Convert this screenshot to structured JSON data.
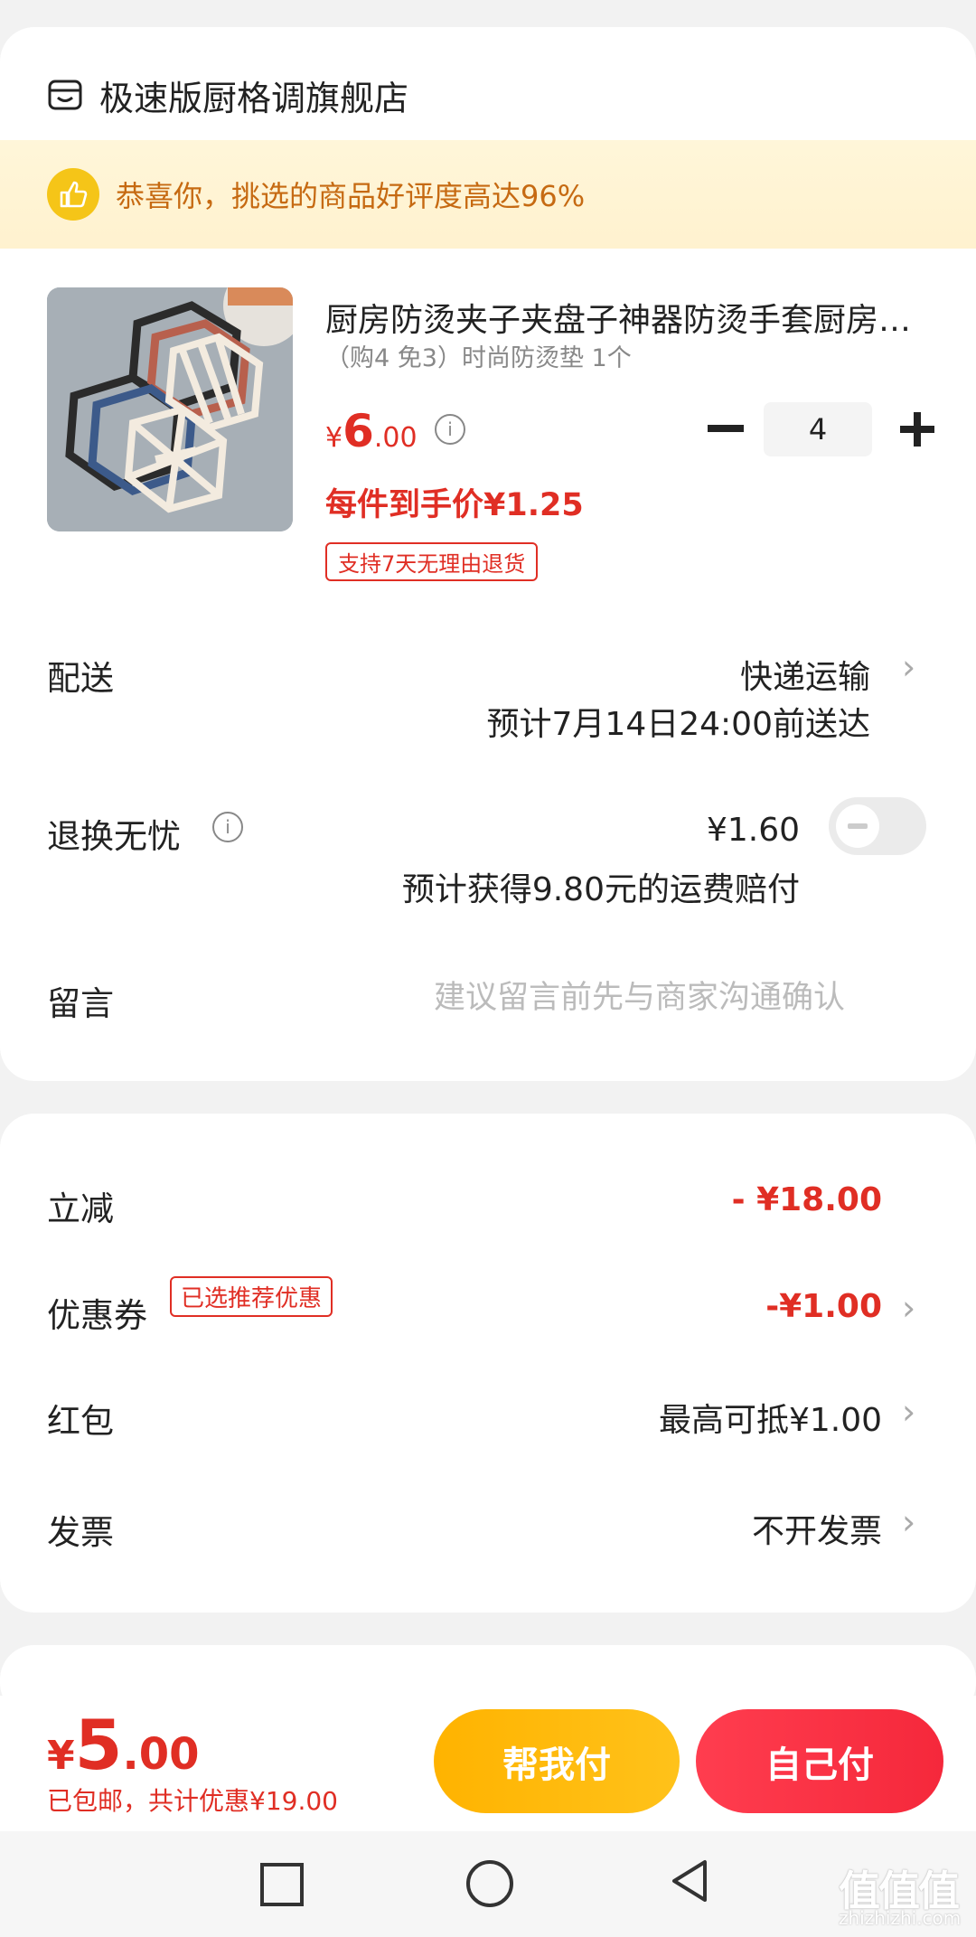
{
  "store": {
    "name": "极速版厨格调旗舰店",
    "icon": "store-icon"
  },
  "banner": {
    "text": "恭喜你，挑选的商品好评度高达96%",
    "icon": "thumbs-up-icon"
  },
  "product": {
    "title": "厨房防烫夹子夹盘子神器防烫手套厨房防烫垫",
    "spec": "（购4 免3）时尚防烫垫 1个",
    "price_symbol": "¥",
    "price_int": "6",
    "price_dec": ".00",
    "unit_price": "每件到手价¥1.25",
    "tag": "支持7天无理由退货",
    "quantity": "4"
  },
  "delivery": {
    "label": "配送",
    "method": "快递运输",
    "eta": "预计7月14日24:00前送达"
  },
  "return_ins": {
    "label": "退换无忧",
    "price": "¥1.60",
    "note": "预计获得9.80元的运费赔付",
    "enabled": false
  },
  "message": {
    "label": "留言",
    "placeholder": "建议留言前先与商家沟通确认"
  },
  "discount": {
    "label": "立减",
    "value": "- ¥18.00"
  },
  "coupon": {
    "label": "优惠券",
    "tag": "已选推荐优惠",
    "value": "-¥1.00"
  },
  "red_packet": {
    "label": "红包",
    "value": "最高可抵¥1.00"
  },
  "invoice": {
    "label": "发票",
    "value": "不开发票"
  },
  "footer": {
    "currency": "¥",
    "total_int": "5",
    "total_dec": ".00",
    "note": "已包邮，共计优惠¥19.00",
    "help_pay": "帮我付",
    "self_pay": "自己付"
  },
  "watermark": {
    "text": "值值值",
    "url": "zhizhizhi.com"
  },
  "colors": {
    "accent": "#e02e24",
    "help_button": "#ffb300",
    "self_button": "#f5283b"
  }
}
